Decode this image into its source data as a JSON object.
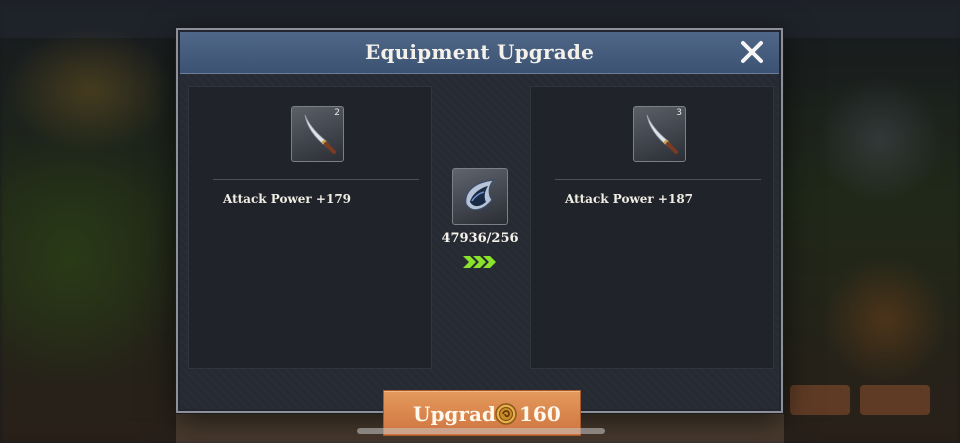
{
  "dialog": {
    "title": "Equipment Upgrade",
    "close_icon": "close-icon"
  },
  "current_item": {
    "icon": "dagger-icon",
    "level": "2",
    "stat": "Attack Power +179"
  },
  "next_item": {
    "icon": "dagger-icon",
    "level": "3",
    "stat": "Attack Power +187"
  },
  "material": {
    "icon": "upgrade-stone-icon",
    "count": "47936/256"
  },
  "progress_icon": "triple-chevron-right-icon",
  "upgrade_button": {
    "label": "Upgrade",
    "currency_icon": "gold-coin-icon",
    "cost": "160"
  },
  "colors": {
    "header": "#4f6788",
    "panel": "#20232a",
    "button": "#d98049",
    "arrow": "#7ed321"
  }
}
